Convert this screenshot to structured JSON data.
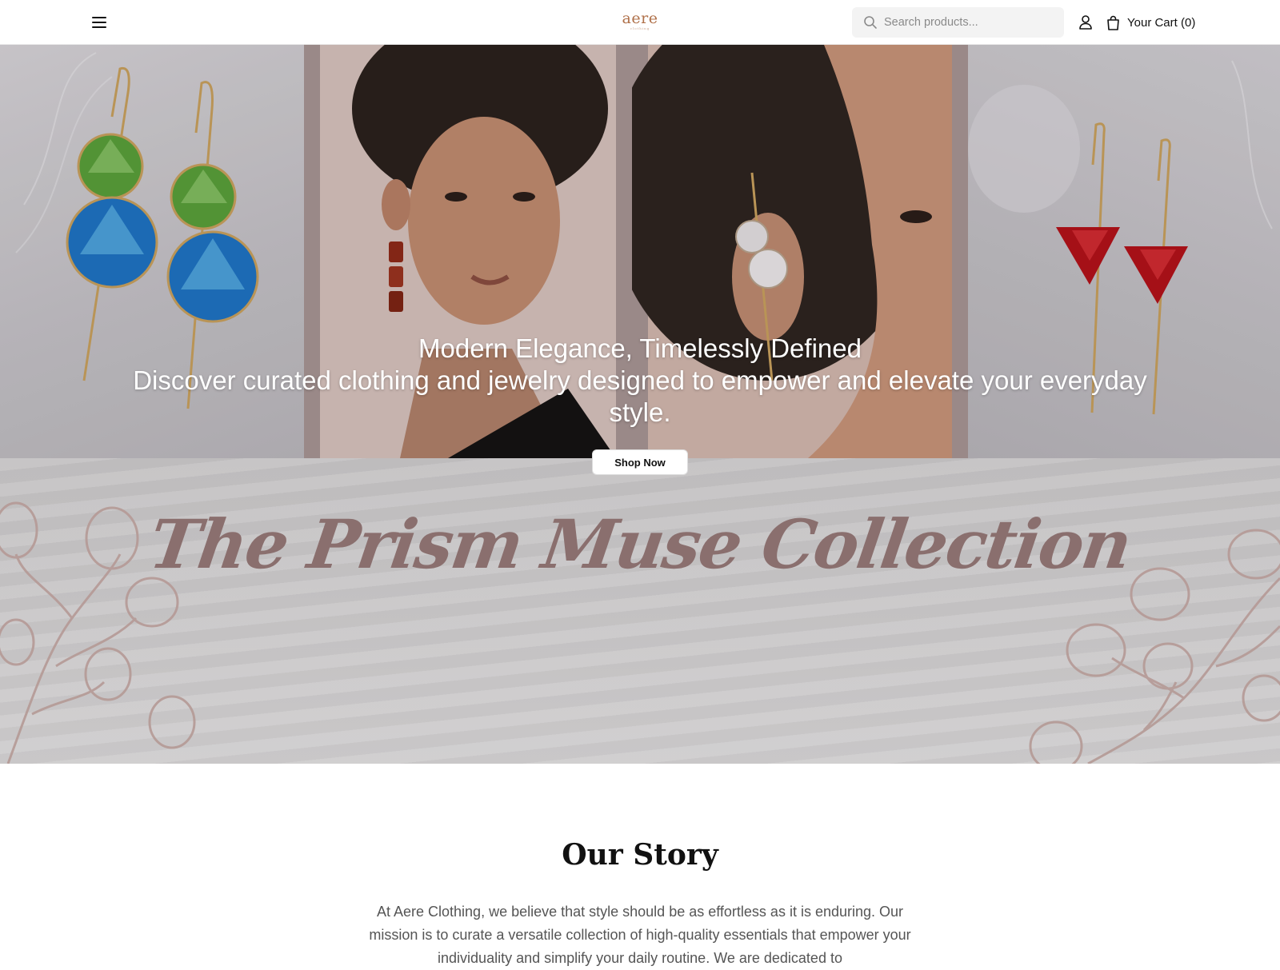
{
  "header": {
    "logo_text": "aere",
    "logo_subtext": "clothing",
    "search_placeholder": "Search products...",
    "cart_label": "Your Cart (0)",
    "icons": [
      "menu-icon",
      "search-icon",
      "user-icon",
      "shopping-bag-icon"
    ]
  },
  "hero": {
    "title": "Modern Elegance, Timelessly Defined",
    "subtitle": "Discover curated clothing and jewelry designed to empower and elevate your everyday style.",
    "cta_label": "Shop Now",
    "collection_title": "The Prism Muse Collection"
  },
  "story": {
    "title": "Our Story",
    "text": "At Aere Clothing, we believe that style should be as effortless as it is enduring. Our mission is to curate a versatile collection of high-quality essentials that empower your individuality and simplify your daily routine. We are dedicated to"
  },
  "colors": {
    "brand": "#b0714a",
    "collection_title": "#8a6f6e",
    "leaf_stroke": "#b59a96"
  }
}
